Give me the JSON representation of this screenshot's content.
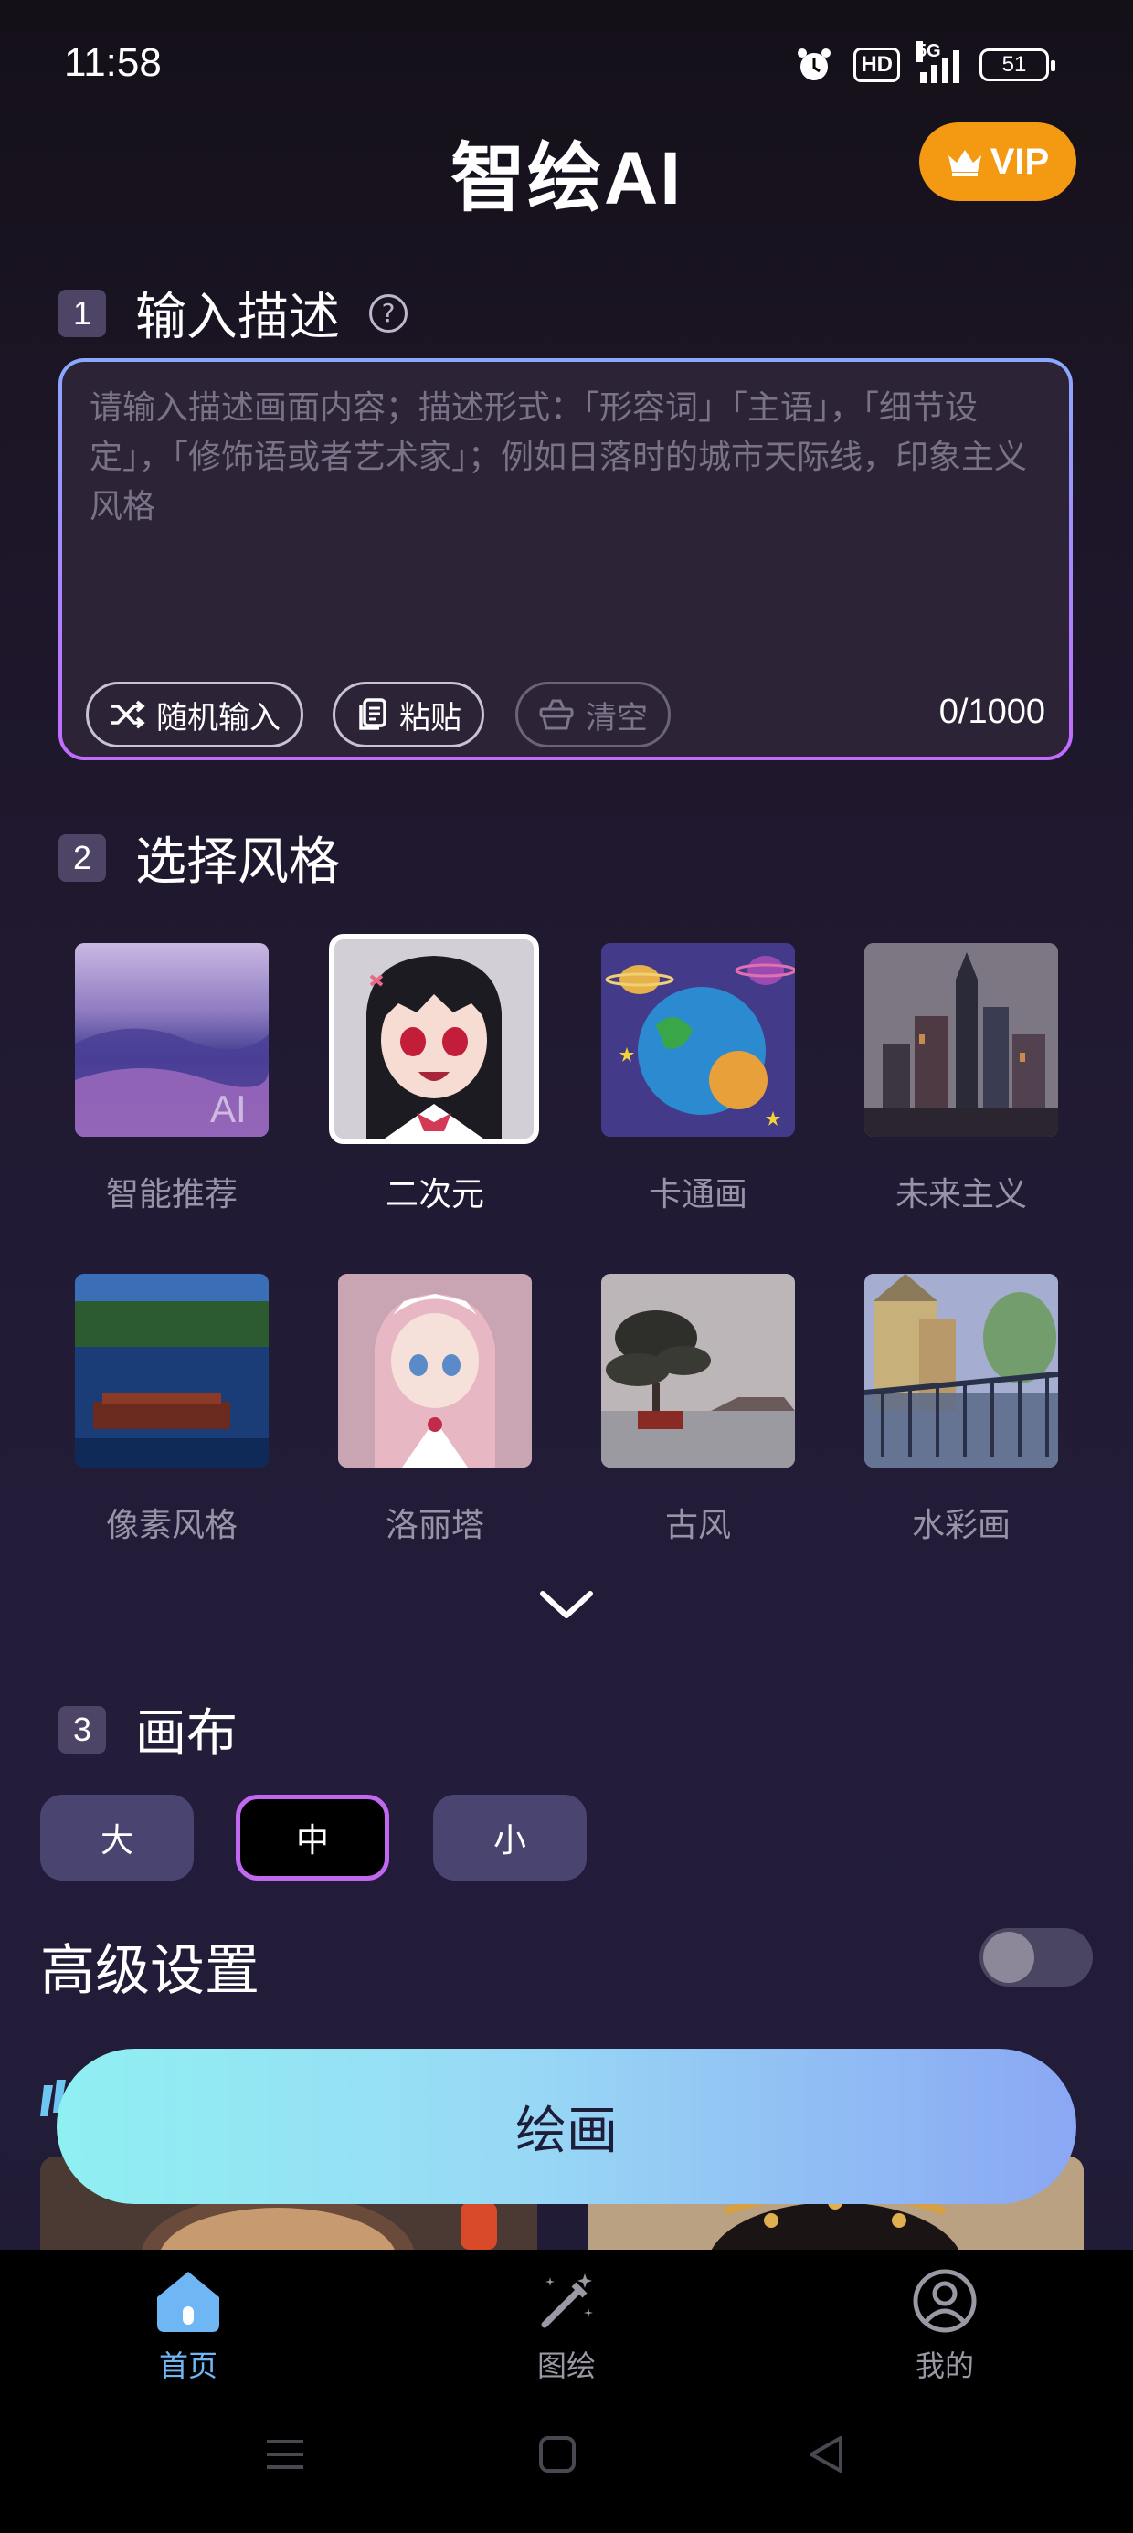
{
  "status_bar": {
    "time": "11:58",
    "hd": "HD",
    "network": "5G",
    "battery": "51"
  },
  "app": {
    "title": "智绘AI",
    "vip_label": "VIP"
  },
  "section1": {
    "number": "1",
    "title": "输入描述",
    "help_icon": "question-circle-icon",
    "placeholder": "请输入描述画面内容；描述形式：「形容词」「主语」，「细节设定」，「修饰语或者艺术家」；例如日落时的城市天际线，印象主义风格",
    "value": "",
    "counter": "0/1000",
    "actions": [
      {
        "label": "随机输入",
        "icon": "shuffle-icon",
        "enabled": true
      },
      {
        "label": "粘贴",
        "icon": "paste-icon",
        "enabled": true
      },
      {
        "label": "清空",
        "icon": "clear-basket-icon",
        "enabled": false
      }
    ]
  },
  "section2": {
    "number": "2",
    "title": "选择风格",
    "styles": [
      {
        "label": "智能推荐",
        "selected": false,
        "badge": "AI"
      },
      {
        "label": "二次元",
        "selected": true
      },
      {
        "label": "卡通画",
        "selected": false
      },
      {
        "label": "未来主义",
        "selected": false
      },
      {
        "label": "像素风格",
        "selected": false
      },
      {
        "label": "洛丽塔",
        "selected": false
      },
      {
        "label": "古风",
        "selected": false
      },
      {
        "label": "水彩画",
        "selected": false
      }
    ],
    "expand_icon": "chevron-down-icon"
  },
  "section3": {
    "number": "3",
    "title": "画布",
    "sizes": [
      {
        "label": "大",
        "selected": false
      },
      {
        "label": "中",
        "selected": true
      },
      {
        "label": "小",
        "selected": false
      }
    ]
  },
  "advanced": {
    "title": "高级设置",
    "enabled": false
  },
  "draw_button": {
    "label": "绘画"
  },
  "bottom_nav": [
    {
      "label": "首页",
      "icon": "home-icon",
      "active": true
    },
    {
      "label": "图绘",
      "icon": "magic-wand-icon",
      "active": false
    },
    {
      "label": "我的",
      "icon": "user-circle-icon",
      "active": false
    }
  ],
  "colors": {
    "accent": "#f39a12",
    "active_tab": "#6fb6f5",
    "selected_border": "#c267f0"
  }
}
